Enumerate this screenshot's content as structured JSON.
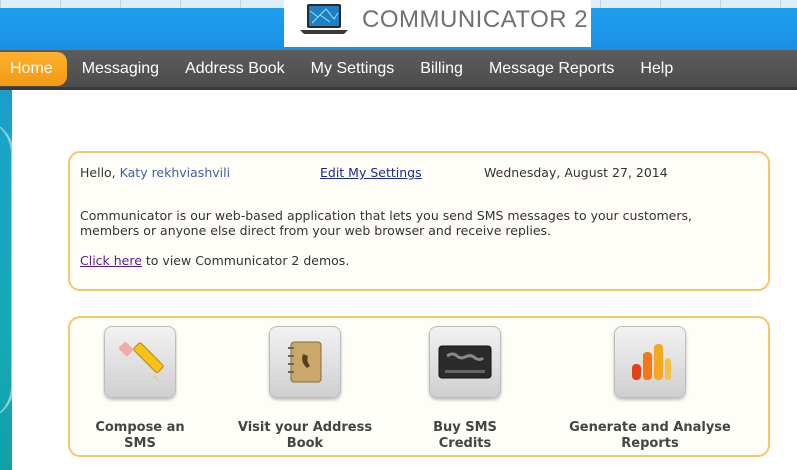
{
  "header": {
    "logo_text": "COMMUNICATOR 2"
  },
  "nav": {
    "items": [
      {
        "label": "Home",
        "active": true
      },
      {
        "label": "Messaging",
        "active": false
      },
      {
        "label": "Address Book",
        "active": false
      },
      {
        "label": "My Settings",
        "active": false
      },
      {
        "label": "Billing",
        "active": false
      },
      {
        "label": "Message Reports",
        "active": false
      },
      {
        "label": "Help",
        "active": false
      }
    ]
  },
  "welcome": {
    "greeting": "Hello,",
    "user_name": "Katy rekhviashvili",
    "edit_settings_link": "Edit My Settings",
    "date": "Wednesday, August 27, 2014",
    "description": "Communicator is our web-based application that lets you send SMS messages to your customers, members or anyone else direct from your web browser and receive replies.",
    "demo_link": "Click here",
    "demo_suffix": " to view Communicator 2 demos."
  },
  "actions": [
    {
      "label": "Compose an SMS",
      "icon": "pencil-icon"
    },
    {
      "label": "Visit your Address Book",
      "icon": "address-book-icon"
    },
    {
      "label": "Buy SMS Credits",
      "icon": "credit-card-icon"
    },
    {
      "label": "Generate and Analyse Reports",
      "icon": "bar-chart-icon"
    }
  ],
  "colors": {
    "banner_blue": "#1b8fe6",
    "nav_gray": "#555555",
    "active_orange": "#f29a12",
    "panel_border": "#f7c66a"
  }
}
